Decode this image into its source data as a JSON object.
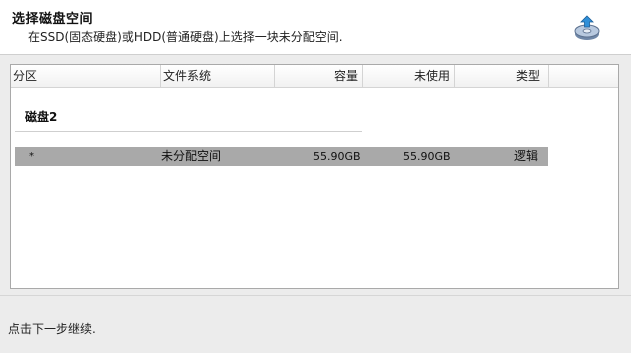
{
  "header": {
    "title": "选择磁盘空间",
    "subtitle": "在SSD(固态硬盘)或HDD(普通硬盘)上选择一块未分配空间.",
    "icon": "disk-install-icon"
  },
  "table": {
    "columns": [
      "分区",
      "文件系统",
      "容量",
      "未使用",
      "类型"
    ],
    "groups": [
      {
        "label": "磁盘2",
        "rows": [
          {
            "partition": "*",
            "filesystem": "未分配空间",
            "capacity": "55.90GB",
            "unused": "55.90GB",
            "type": "逻辑"
          }
        ]
      }
    ]
  },
  "footer": {
    "text": "点击下一步继续."
  },
  "colors": {
    "selected_row": "#a9a9a9",
    "panel_border": "#a9a9a9",
    "background": "#ececec"
  }
}
